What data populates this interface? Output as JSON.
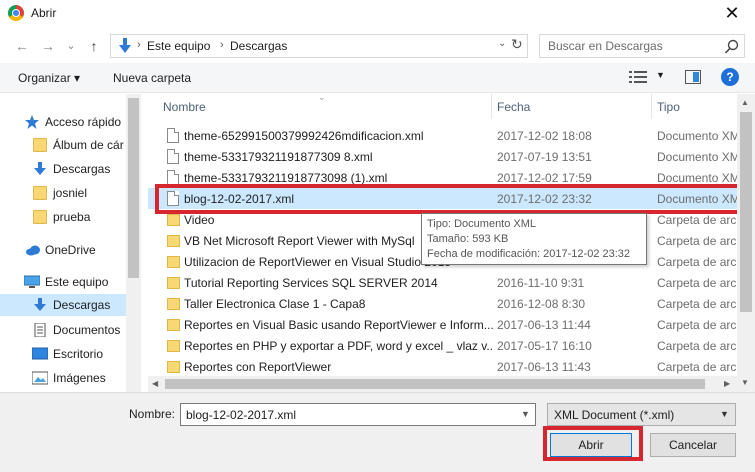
{
  "window": {
    "title": "Abrir",
    "close_glyph": "✕"
  },
  "nav": {
    "back_glyph": "←",
    "forward_glyph": "→",
    "recent_glyph": "⌄",
    "up_glyph": "↑",
    "breadcrumb": [
      "Este equipo",
      "Descargas"
    ],
    "search_placeholder": "Buscar en Descargas"
  },
  "toolbar": {
    "organize": "Organizar ▾",
    "new_folder": "Nueva carpeta",
    "help": "?"
  },
  "sidebar": {
    "items": [
      {
        "label": "Acceso rápido",
        "icon": "star-icon"
      },
      {
        "label": "Álbum de cár",
        "icon": "folder-icon"
      },
      {
        "label": "Descargas",
        "icon": "download-arrow-icon"
      },
      {
        "label": "josniel",
        "icon": "folder-icon"
      },
      {
        "label": "prueba",
        "icon": "folder-icon"
      },
      {
        "label": "OneDrive",
        "icon": "cloud-icon"
      },
      {
        "label": "Este equipo",
        "icon": "computer-icon"
      },
      {
        "label": "Descargas",
        "icon": "download-arrow-icon"
      },
      {
        "label": "Documentos",
        "icon": "documents-icon"
      },
      {
        "label": "Escritorio",
        "icon": "desktop-icon"
      },
      {
        "label": "Imágenes",
        "icon": "pictures-icon"
      }
    ]
  },
  "columns": {
    "name": "Nombre",
    "date": "Fecha",
    "type": "Tipo"
  },
  "files": [
    {
      "name": "theme-652991500379992426mdificacion.xml",
      "date": "2017-12-02 18:08",
      "type": "Documento XML",
      "kind": "file"
    },
    {
      "name": "theme-533179321191877309 8.xml",
      "date": "2017-07-19 13:51",
      "type": "Documento XML",
      "kind": "file"
    },
    {
      "name": "theme-5331793211918773098 (1).xml",
      "date": "2017-12-02 17:59",
      "type": "Documento XML",
      "kind": "file"
    },
    {
      "name": "blog-12-02-2017.xml",
      "date": "2017-12-02 23:32",
      "type": "Documento XML",
      "kind": "file",
      "selected": true
    },
    {
      "name": "Video",
      "date": "",
      "type": "Carpeta de archivos",
      "kind": "folder"
    },
    {
      "name": "VB Net Microsoft Report Viewer with MySql",
      "date": "",
      "type": "Carpeta de archivos",
      "kind": "folder"
    },
    {
      "name": "Utilizacion de ReportViewer en Visual Studio 2015",
      "date": "",
      "type": "Carpeta de archivos",
      "kind": "folder"
    },
    {
      "name": "Tutorial Reporting Services SQL SERVER 2014",
      "date": "2016-11-10 9:31",
      "type": "Carpeta de archivos",
      "kind": "folder"
    },
    {
      "name": "Taller Electronica Clase 1 - Capa8",
      "date": "2016-12-08 8:30",
      "type": "Carpeta de archivos",
      "kind": "folder"
    },
    {
      "name": "Reportes en Visual Basic usando ReportViewer e Inform...",
      "date": "2017-06-13 11:44",
      "type": "Carpeta de archivos",
      "kind": "folder"
    },
    {
      "name": "Reportes en PHP y exportar a PDF, word y excel _ vlaz v...",
      "date": "2017-05-17 16:10",
      "type": "Carpeta de archivos",
      "kind": "folder"
    },
    {
      "name": "Reportes con ReportViewer",
      "date": "2017-06-13 11:43",
      "type": "Carpeta de archivos",
      "kind": "folder"
    }
  ],
  "tooltip": {
    "type_line": "Tipo: Documento XML",
    "size_line": "Tamaño: 593 KB",
    "modified_line": "Fecha de modificación: 2017-12-02 23:32"
  },
  "bottom": {
    "filename_label": "Nombre:",
    "filename_value": "blog-12-02-2017.xml",
    "filetype_value": "XML Document (*.xml)",
    "open_label": "Abrir",
    "cancel_label": "Cancelar"
  },
  "colors": {
    "selection": "#cce8ff",
    "highlight": "#d6262f",
    "accent": "#0078d7"
  }
}
